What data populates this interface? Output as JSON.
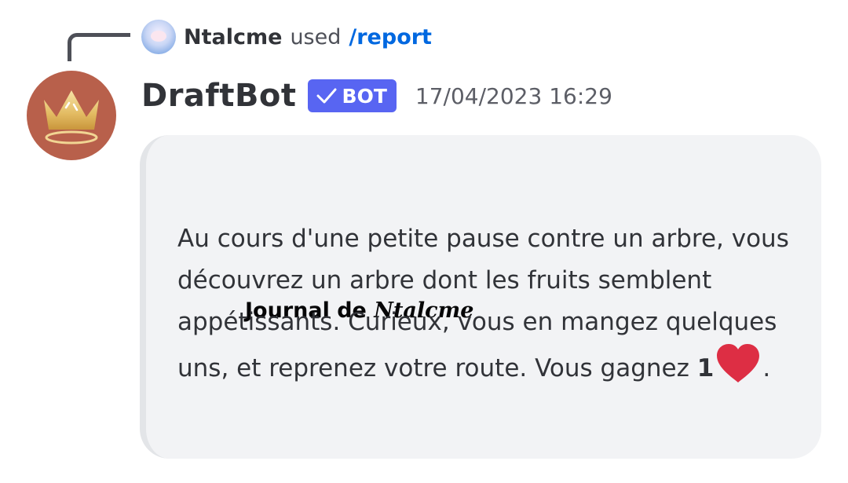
{
  "reply": {
    "username": "Ntalcme",
    "used_text": "used",
    "command": "/report"
  },
  "message": {
    "author": "DraftBot",
    "bot_badge": "BOT",
    "timestamp": "17/04/2023 16:29"
  },
  "embed": {
    "title_prefix": "Journal de",
    "title_name": "Ntalcme",
    "body_text": "Au cours d'une petite pause contre un arbre, vous découvrez un arbre dont les fruits semblent appétissants. Curieux, vous en mangez quelques uns, et reprenez votre route. Vous gagnez",
    "reward_amount": "1",
    "reward_icon": "heart-icon",
    "body_end": "."
  },
  "colors": {
    "bot_badge": "#5865f2",
    "command_link": "#0068e0",
    "avatar_bg": "#b8604b",
    "heart": "#dd2e44",
    "embed_bg": "#f2f3f5"
  }
}
